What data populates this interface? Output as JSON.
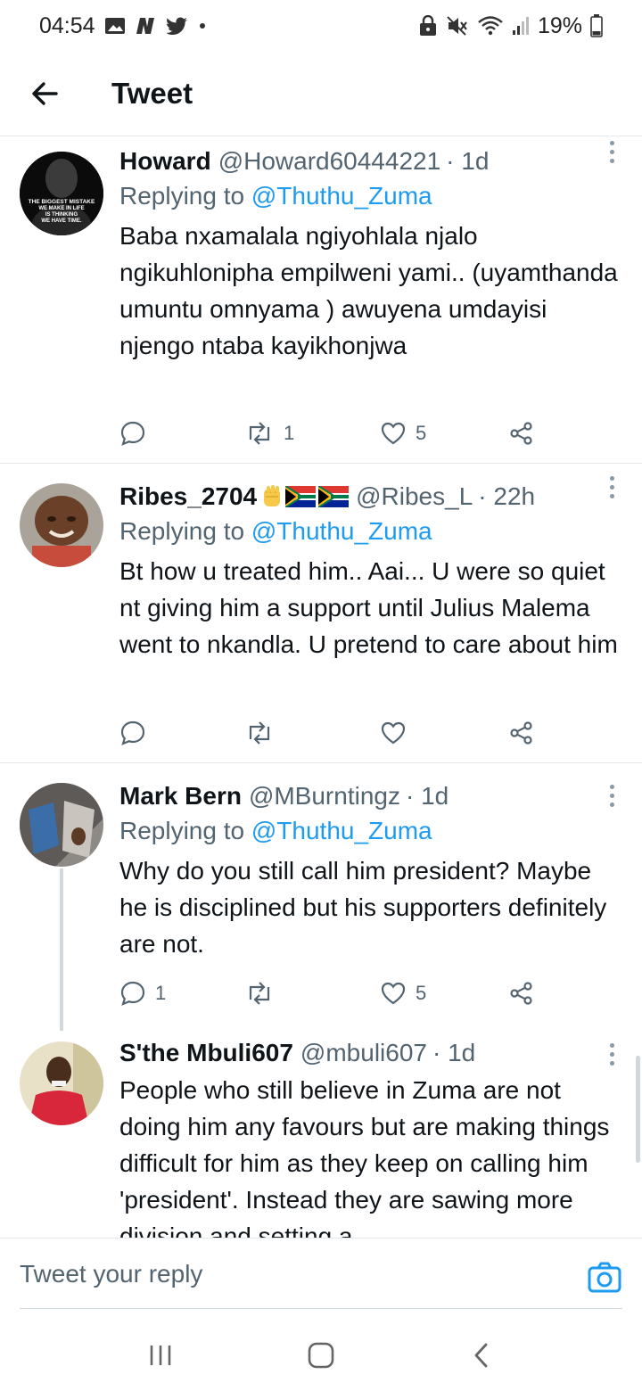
{
  "status_bar": {
    "time": "04:54",
    "battery": "19%"
  },
  "header": {
    "title": "Tweet"
  },
  "tweets": [
    {
      "name": "Howard",
      "handle": "@Howard60444221",
      "time": "· 1d",
      "replying_prefix": "Replying to",
      "replying_to": "@Thuthu_Zuma",
      "text": "Baba nxamalala ngiyohlala njalo ngikuhlonipha empilweni yami.. (uyamthanda umuntu omnyama ) awuyena umdayisi njengo ntaba kayikhonjwa",
      "avatar_text": "THE BIGGEST MISTAKE WE MAKE IN LIFE IS THINKING WE HAVE TIME.",
      "retweets": "1",
      "likes": "5",
      "replies": ""
    },
    {
      "name": "Ribes_2704",
      "handle": "@Ribes_L",
      "time": "· 22h",
      "replying_prefix": "Replying to",
      "replying_to": "@Thuthu_Zuma",
      "text": "Bt how u treated him.. Aai... U were so quiet nt giving him a support until Julius Malema went to nkandla. U pretend to care about him",
      "retweets": "",
      "likes": "",
      "replies": ""
    },
    {
      "name": "Mark Bern",
      "handle": "@MBurntingz",
      "time": "· 1d",
      "replying_prefix": "Replying to",
      "replying_to": "@Thuthu_Zuma",
      "text": "Why do you still call him president? Maybe he is disciplined but his supporters definitely are not.",
      "retweets": "",
      "likes": "5",
      "replies": "1"
    },
    {
      "name": "S'the Mbuli607",
      "handle": "@mbuli607",
      "time": "· 1d",
      "text": "People who still believe in Zuma are not doing him any favours but are making things difficult for him as they keep on calling him 'president'. Instead they are sawing more division and setting a"
    }
  ],
  "reply_bar": {
    "placeholder": "Tweet your reply"
  },
  "icons": {
    "back": "arrow-left-icon",
    "more": "more-vertical-icon",
    "reply": "comment-icon",
    "retweet": "retweet-icon",
    "like": "heart-icon",
    "share": "share-icon",
    "camera": "camera-icon"
  },
  "colors": {
    "mention": "#1d9bf0",
    "secondary_text": "#536471",
    "divider": "#e6e9eb"
  }
}
